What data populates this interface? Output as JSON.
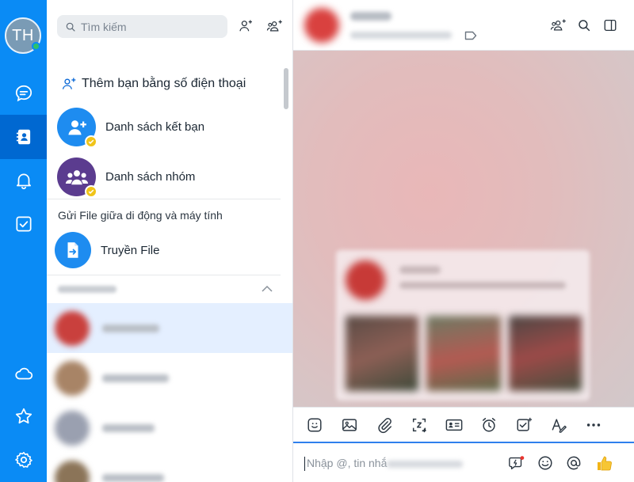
{
  "profile": {
    "initials": "TH"
  },
  "search": {
    "placeholder": "Tìm kiếm"
  },
  "contacts_panel": {
    "add_by_phone": "Thêm bạn bằng số điện thoại",
    "friend_list": "Danh sách kết bạn",
    "group_list": "Danh sách nhóm",
    "file_section": "Gửi File giữa di động và máy tính",
    "file_transfer": "Truyền File"
  },
  "composer": {
    "placeholder": "Nhập @, tin nhắ"
  },
  "colors": {
    "rail": "#0a8bf5",
    "rail_active": "#0068d1",
    "accent": "#0a8bf5",
    "selected_row": "#e4efff",
    "badge": "#f0c419",
    "group_icon": "#5b3c8f"
  },
  "icons": {
    "rail": [
      "message-icon",
      "contacts-icon",
      "bell-icon",
      "todo-check-icon",
      "cloud-icon",
      "star-icon",
      "settings-icon"
    ],
    "toolbar": [
      "sticker-icon",
      "image-icon",
      "attachment-icon",
      "screenshot-icon",
      "contact-card-icon",
      "reminder-clock-icon",
      "task-icon",
      "text-format-icon",
      "more-icon"
    ],
    "composer": [
      "quick-message-icon",
      "emoji-icon",
      "mention-icon",
      "like-icon"
    ]
  }
}
